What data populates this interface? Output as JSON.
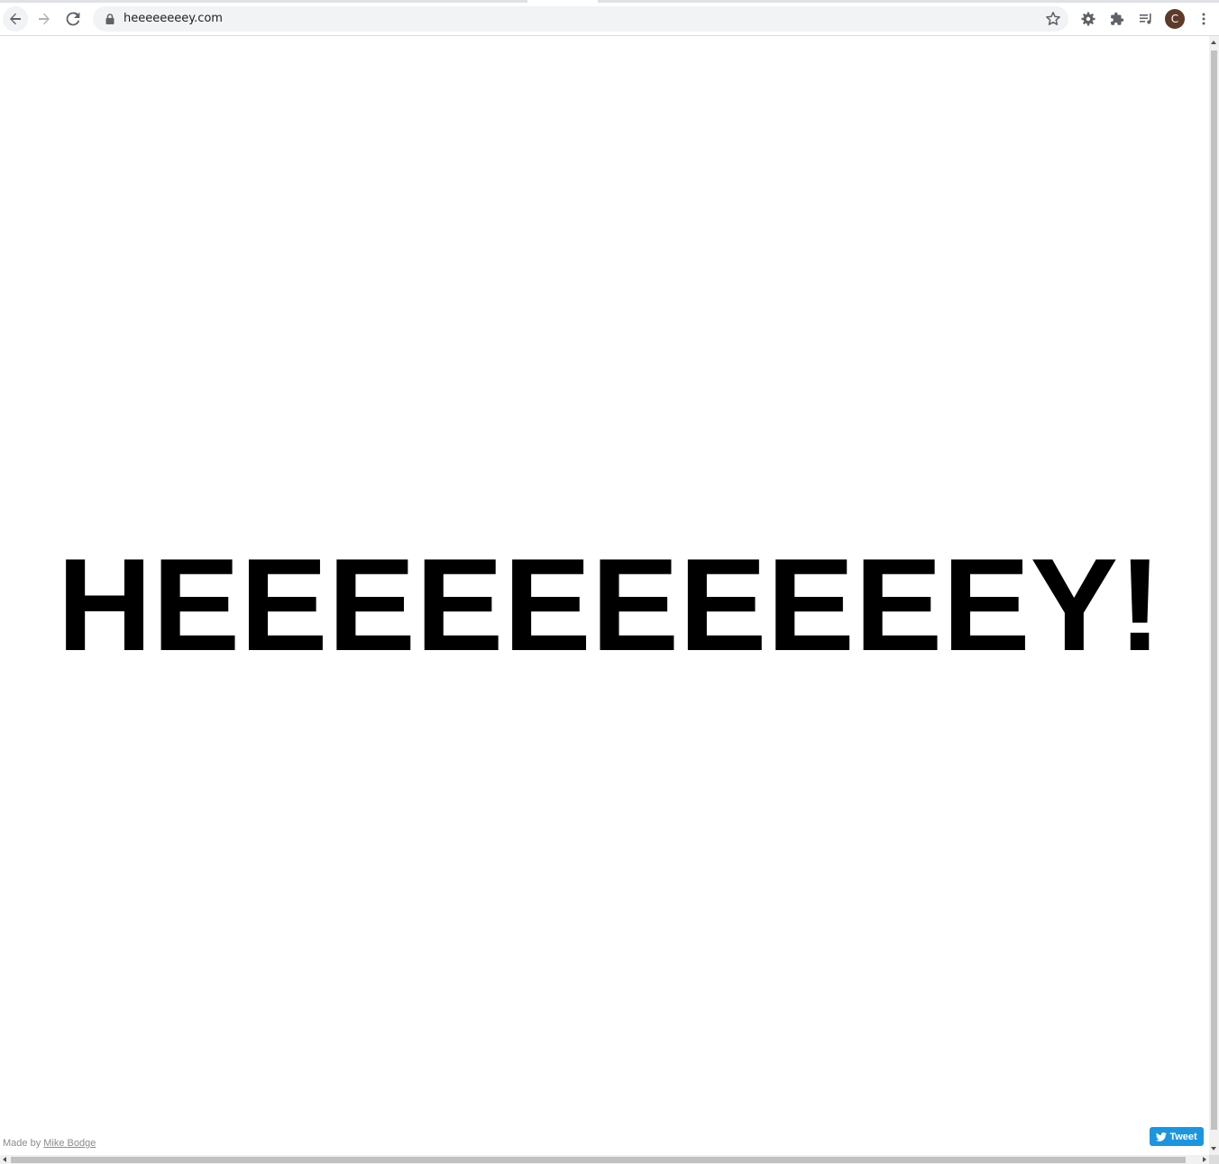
{
  "browser": {
    "url": "heeeeeeeey.com",
    "profile_initial": "C",
    "icons": {
      "back": "arrow-left-icon",
      "forward": "arrow-right-icon",
      "reload": "reload-icon",
      "lock": "lock-icon",
      "bookmark": "star-icon",
      "extension_gear": "gear-icon",
      "extensions": "puzzle-icon",
      "media": "playlist-icon",
      "menu": "kebab-menu-icon"
    },
    "colors": {
      "avatar": "#5d3a2a",
      "toolbar": "#ffffff",
      "omnibox": "#f1f3f4"
    }
  },
  "page": {
    "headline": "HEEEEEEEEEEY!",
    "credit_prefix": "Made by",
    "credit_author": "Mike Bodge",
    "tweet_label": "Tweet",
    "colors": {
      "headline": "#000000",
      "tweet_button": "#1b95e0",
      "credit": "#8c8c8c"
    }
  }
}
